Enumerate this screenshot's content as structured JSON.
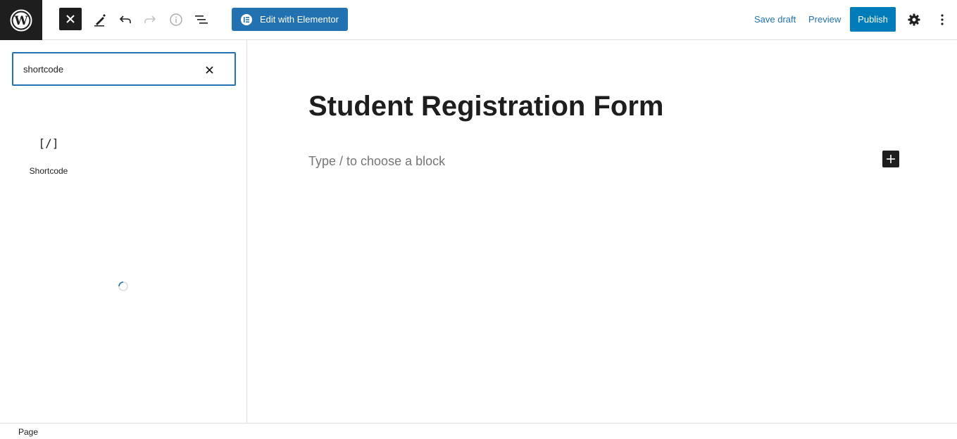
{
  "toolbar": {
    "wp_logo_icon": "wordpress-logo-icon",
    "close_inserter_icon": "close-icon",
    "tools_icon": "pencil-icon",
    "undo_icon": "undo-icon",
    "redo_icon": "redo-icon",
    "details_icon": "info-icon",
    "list_view_icon": "list-view-icon",
    "elementor_label": "Edit with Elementor",
    "save_draft_label": "Save draft",
    "preview_label": "Preview",
    "publish_label": "Publish",
    "settings_icon": "gear-icon",
    "options_icon": "vertical-ellipsis-icon",
    "accent_color": "#2271b1",
    "publish_color": "#007cba"
  },
  "inserter": {
    "search_value": "shortcode",
    "clear_icon": "close-icon",
    "results": [
      {
        "icon_text": "[/]",
        "label": "Shortcode"
      }
    ],
    "loading_icon": "spinner-icon"
  },
  "canvas": {
    "title": "Student Registration Form",
    "placeholder": "Type / to choose a block",
    "add_block_icon": "plus-icon"
  },
  "footer": {
    "breadcrumb": "Page"
  }
}
